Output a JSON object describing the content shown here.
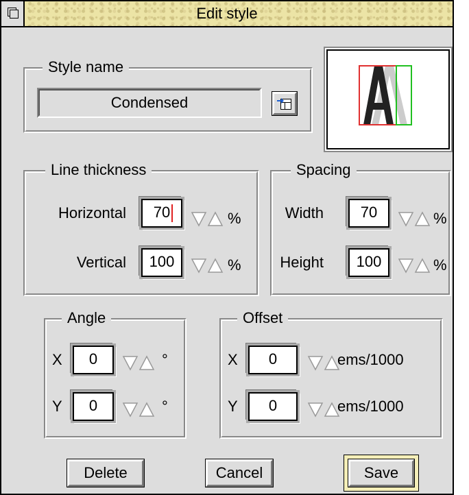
{
  "window": {
    "title": "Edit style",
    "icons": {
      "back": "window-back-icon",
      "pick": "pick-style-icon",
      "down": "down-arrow-icon",
      "up": "up-arrow-icon"
    }
  },
  "style_name": {
    "label": "Style name",
    "value": "Condensed"
  },
  "line_thickness": {
    "label": "Line thickness",
    "horizontal_label": "Horizontal",
    "horizontal_value": "70",
    "horizontal_unit": "%",
    "vertical_label": "Vertical",
    "vertical_value": "100",
    "vertical_unit": "%"
  },
  "spacing": {
    "label": "Spacing",
    "width_label": "Width",
    "width_value": "70",
    "width_unit": "%",
    "height_label": "Height",
    "height_value": "100",
    "height_unit": "%"
  },
  "angle": {
    "label": "Angle",
    "x_label": "X",
    "x_value": "0",
    "x_unit": "°",
    "y_label": "Y",
    "y_value": "0",
    "y_unit": "°"
  },
  "offset": {
    "label": "Offset",
    "x_label": "X",
    "x_value": "0",
    "x_unit": "ems/1000",
    "y_label": "Y",
    "y_value": "0",
    "y_unit": "ems/1000"
  },
  "preview": {
    "glyph": "A",
    "colors": {
      "box_red": "#e03030",
      "box_green": "#20c020",
      "glyph": "#222222",
      "shadow": "#cccccc"
    }
  },
  "buttons": {
    "delete": "Delete",
    "cancel": "Cancel",
    "save": "Save"
  }
}
